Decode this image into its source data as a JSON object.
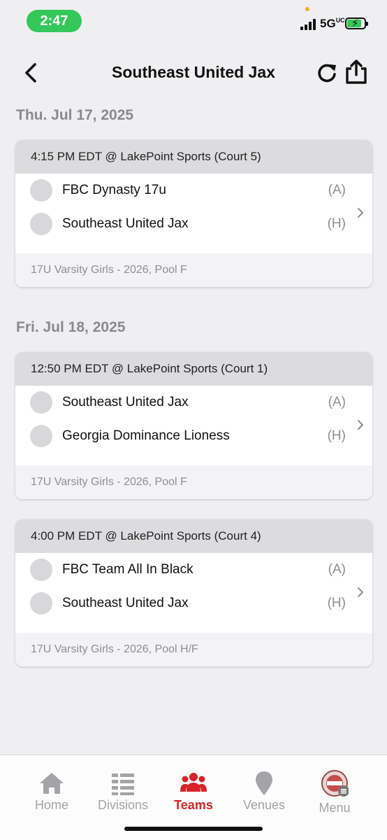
{
  "status_bar": {
    "time": "2:47",
    "network": "5G",
    "network_suffix": "UC",
    "colors": {
      "time_pill": "#34c759",
      "battery": "#34c759",
      "dot": "#f5a623"
    }
  },
  "header": {
    "title": "Southeast United Jax",
    "back_icon": "chevron-left-icon",
    "refresh_icon": "refresh-icon",
    "share_icon": "share-icon"
  },
  "schedule": [
    {
      "date": "Thu. Jul 17, 2025",
      "games": [
        {
          "time_venue": "4:15 PM EDT @ LakePoint Sports (Court 5)",
          "teams": [
            {
              "name": "FBC Dynasty 17u",
              "side": "(A)"
            },
            {
              "name": "Southeast United Jax",
              "side": "(H)"
            }
          ],
          "division": "17U Varsity Girls - 2026, Pool F"
        }
      ]
    },
    {
      "date": "Fri. Jul 18, 2025",
      "games": [
        {
          "time_venue": "12:50 PM EDT @ LakePoint Sports (Court 1)",
          "teams": [
            {
              "name": "Southeast United Jax",
              "side": "(A)"
            },
            {
              "name": "Georgia Dominance Lioness",
              "side": "(H)"
            }
          ],
          "division": "17U Varsity Girls - 2026, Pool F"
        },
        {
          "time_venue": "4:00 PM EDT @ LakePoint Sports (Court 4)",
          "teams": [
            {
              "name": "FBC Team All In Black",
              "side": "(A)"
            },
            {
              "name": "Southeast United Jax",
              "side": "(H)"
            }
          ],
          "division": "17U Varsity Girls - 2026, Pool H/F"
        }
      ]
    }
  ],
  "tab_bar": {
    "tabs": [
      {
        "label": "Home",
        "icon": "home-icon",
        "active": false
      },
      {
        "label": "Divisions",
        "icon": "divisions-icon",
        "active": false
      },
      {
        "label": "Teams",
        "icon": "teams-icon",
        "active": true
      },
      {
        "label": "Venues",
        "icon": "venue-pin-icon",
        "active": false
      },
      {
        "label": "Menu",
        "icon": "menu-logo-icon",
        "active": false
      }
    ],
    "colors": {
      "active": "#d9232a",
      "inactive": "#a4a4a8"
    }
  }
}
